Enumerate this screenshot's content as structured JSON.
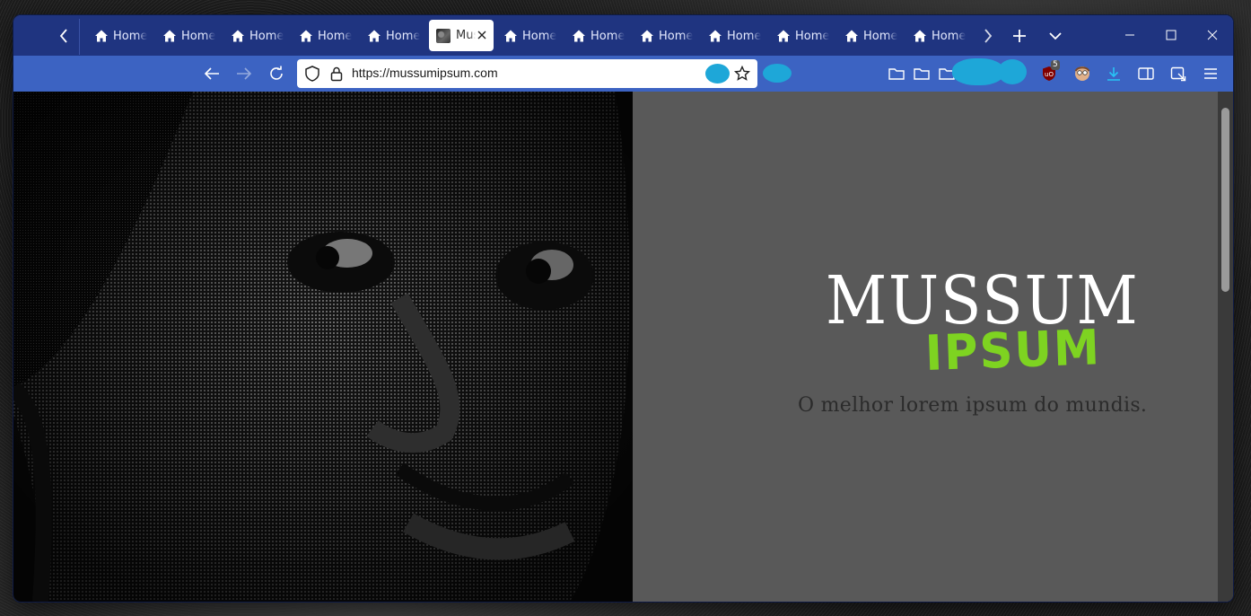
{
  "browser": {
    "tabs": [
      {
        "label": "Home",
        "icon": "home-icon",
        "active": false
      },
      {
        "label": "Home",
        "icon": "home-icon",
        "active": false
      },
      {
        "label": "Home",
        "icon": "home-icon",
        "active": false
      },
      {
        "label": "Home",
        "icon": "home-icon",
        "active": false
      },
      {
        "label": "Home",
        "icon": "home-icon",
        "active": false
      },
      {
        "label": "Mussum Ipsum",
        "icon": "site-thumbnail-icon",
        "active": true
      },
      {
        "label": "Home",
        "icon": "home-icon",
        "active": false
      },
      {
        "label": "Home",
        "icon": "home-icon",
        "active": false
      },
      {
        "label": "Home",
        "icon": "home-icon",
        "active": false
      },
      {
        "label": "Home",
        "icon": "home-icon",
        "active": false
      },
      {
        "label": "Home",
        "icon": "home-icon",
        "active": false
      },
      {
        "label": "Home",
        "icon": "home-icon",
        "active": false
      },
      {
        "label": "Home",
        "icon": "home-icon",
        "active": false
      }
    ],
    "url": "https://mussumipsum.com",
    "extension_badge": "5",
    "colors": {
      "tabbar": "#1f3480",
      "navbar": "#3c63c2",
      "redaction": "#1ea7d8"
    }
  },
  "page": {
    "title": "MUSSUM",
    "subtitle": "IPSUM",
    "tagline": "O melhor lorem ipsum do mundis.",
    "colors": {
      "background": "#595959",
      "title": "#ffffff",
      "subtitle": "#7ed321",
      "tagline": "#2b2b2b"
    }
  }
}
